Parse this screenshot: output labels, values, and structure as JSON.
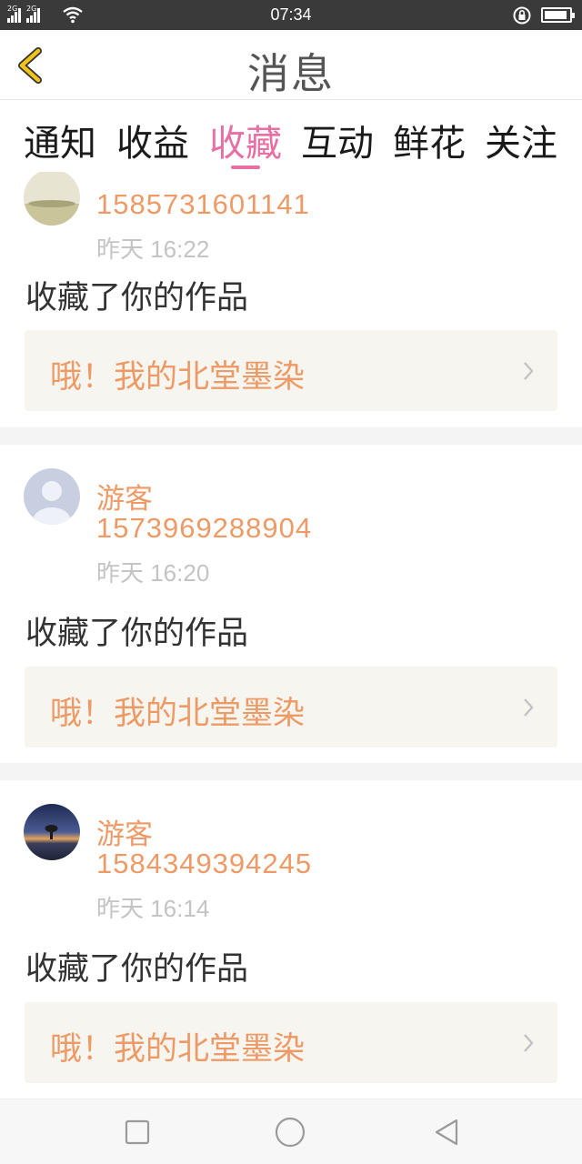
{
  "status_bar": {
    "network_1": "2G",
    "network_2": "2G",
    "time": "07:34",
    "battery_level": 0.92,
    "icons": [
      "signal-icon",
      "wifi-icon",
      "rotation-lock-icon",
      "battery-icon"
    ]
  },
  "header": {
    "title": "消息",
    "back_icon": "chevron-left-icon",
    "accent_color": "#f0c419"
  },
  "tabs": [
    {
      "label": "通知",
      "active": false
    },
    {
      "label": "收益",
      "active": false
    },
    {
      "label": "收藏",
      "active": true
    },
    {
      "label": "互动",
      "active": false
    },
    {
      "label": "鲜花",
      "active": false
    },
    {
      "label": "关注",
      "active": false
    }
  ],
  "active_tab_color": "#e76fa4",
  "feed": [
    {
      "avatar": "landscape-avatar",
      "username": "",
      "user_id": "1585731601141",
      "time": "昨天 16:22",
      "action": "收藏了你的作品",
      "work_title": "哦！我的北堂墨染"
    },
    {
      "avatar": "default-person-avatar",
      "username": "游客",
      "user_id": "1573969288904",
      "time": "昨天 16:20",
      "action": "收藏了你的作品",
      "work_title": "哦！我的北堂墨染"
    },
    {
      "avatar": "night-sky-avatar",
      "username": "游客",
      "user_id": "1584349394245",
      "time": "昨天 16:14",
      "action": "收藏了你的作品",
      "work_title": "哦！我的北堂墨染"
    }
  ],
  "colors": {
    "name_color": "#ee9a66",
    "time_color": "#c4c4c4",
    "card_bg": "#f6f5ef"
  },
  "nav_bar": {
    "icons": [
      "recent-apps-icon",
      "home-icon",
      "back-icon"
    ]
  }
}
